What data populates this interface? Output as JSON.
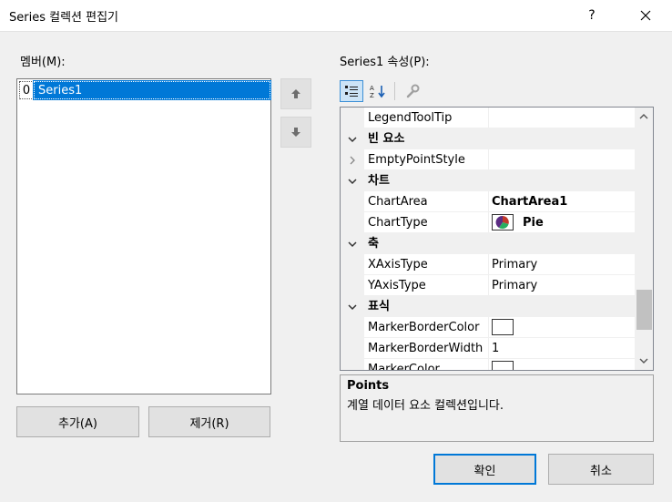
{
  "window": {
    "title": "Series 컬렉션 편집기",
    "help_label": "?",
    "close_icon": "close-icon"
  },
  "members": {
    "label": "멤버(M):",
    "items": [
      {
        "index": "0",
        "name": "Series1"
      }
    ]
  },
  "buttons": {
    "add": "추가(A)",
    "remove": "제거(R)",
    "ok": "확인",
    "cancel": "취소"
  },
  "properties": {
    "label": "Series1 속성(P):",
    "rows": [
      {
        "kind": "prop",
        "name": "LegendToolTip",
        "value": ""
      },
      {
        "kind": "cat",
        "name": "빈 요소"
      },
      {
        "kind": "prop",
        "name": "EmptyPointStyle",
        "value": "",
        "expander": "chevron-right"
      },
      {
        "kind": "cat",
        "name": "차트"
      },
      {
        "kind": "prop",
        "name": "ChartArea",
        "value": "ChartArea1",
        "bold": true
      },
      {
        "kind": "prop",
        "name": "ChartType",
        "value": "Pie",
        "bold": true,
        "icon": "pie-chart-icon"
      },
      {
        "kind": "cat",
        "name": "축"
      },
      {
        "kind": "prop",
        "name": "XAxisType",
        "value": "Primary"
      },
      {
        "kind": "prop",
        "name": "YAxisType",
        "value": "Primary"
      },
      {
        "kind": "cat",
        "name": "표식"
      },
      {
        "kind": "prop",
        "name": "MarkerBorderColor",
        "value": "",
        "swatch": "#ffffff"
      },
      {
        "kind": "prop",
        "name": "MarkerBorderWidth",
        "value": "1"
      },
      {
        "kind": "prop",
        "name": "MarkerColor",
        "value": "",
        "swatch": "#ffffff"
      }
    ]
  },
  "description": {
    "title": "Points",
    "text": "계열 데이터 요소 컬렉션입니다."
  },
  "colors": {
    "selection": "#0078d7",
    "background": "#f0f0f0"
  }
}
